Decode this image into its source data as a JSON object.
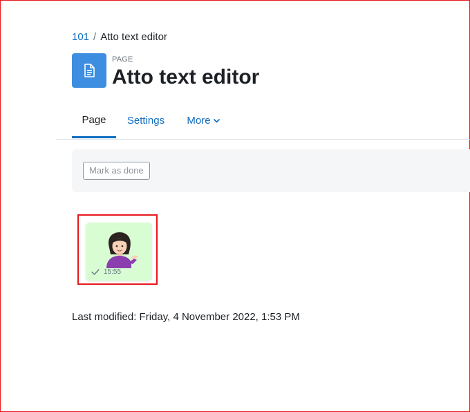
{
  "breadcrumb": {
    "course": "101",
    "separator": "/",
    "current": "Atto text editor"
  },
  "header": {
    "icon": "page-document-icon",
    "icon_color": "#3d8ee1",
    "label": "PAGE",
    "title": "Atto text editor"
  },
  "tabs": [
    {
      "label": "Page",
      "active": true
    },
    {
      "label": "Settings",
      "active": false
    },
    {
      "label": "More",
      "active": false,
      "icon": "chevron-down-icon"
    }
  ],
  "completion": {
    "button_label": "Mark as done"
  },
  "content": {
    "sticker": {
      "icon": "woman-tipping-hand-emoji",
      "time": "15:55",
      "status_icon": "check-icon",
      "bubble_color": "#d8fdd2"
    }
  },
  "footer": {
    "last_modified": "Last modified: Friday, 4 November 2022, 1:53 PM"
  },
  "colors": {
    "accent": "#0f6cbf",
    "highlight_outline": "#e8171b"
  }
}
